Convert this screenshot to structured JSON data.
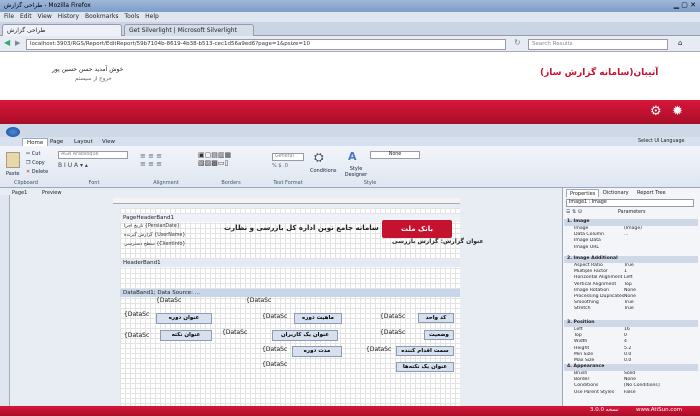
{
  "browser": {
    "title": "طراحی گزارش - Mozilla Firefox",
    "menu": [
      "File",
      "Edit",
      "View",
      "History",
      "Bookmarks",
      "Tools",
      "Help"
    ],
    "tabs": [
      "طراحی گزارش",
      "Get Silverlight | Microsoft Silverlight"
    ],
    "url": "localhost:3903/RGS/Report/EditReport/59b7104b-8619-4b38-b513-cec1d56a9ed6?page=1&psize=10",
    "search_placeholder": "Search Results"
  },
  "app": {
    "brand": "آتیبان(سامانه گزارش ساز)",
    "welcome": "خوش آمدید حسن حسین پور",
    "logout": "خروج از سیستم"
  },
  "ribbon": {
    "tabs": [
      "Home",
      "Page",
      "Layout",
      "View"
    ],
    "right_link": "Select UI Language",
    "buttons": {
      "paste": "Paste",
      "cut": "Cut",
      "copy": "Copy",
      "delete": "Delete",
      "conditions": "Conditions",
      "style_designer": "Style Designer"
    },
    "font_value": "AGA Arabesque",
    "format_value": "General",
    "style_value": "None",
    "groups": [
      "Clipboard",
      "Font",
      "Alignment",
      "Borders",
      "Text Format",
      "Style"
    ]
  },
  "doc_tabs": [
    "Page1",
    "Preview"
  ],
  "report": {
    "bands": {
      "header": "PageHeaderBand1",
      "header2": "HeaderBand1",
      "data": "DataBand1; Data Source: ..."
    },
    "header_title": "سامانه جامع نوین اداره کل بازرسی و نظارت",
    "header_subtitle": "عنوان گزارش: گزارش بازرسی",
    "logo": "بانک ملت",
    "header_fields": [
      "تاریخ اجرا {PersianDate}",
      "گزارش گیرنده {UserName}",
      "سطح دسترسی {ClientInfo}"
    ],
    "labels": [
      "کد واحد",
      "وضعیت",
      "سمت اقدام کننده",
      "عنوان یک نکته‌ها",
      "ماهیت دوره",
      "عنوان یک کاربران",
      "مدت دوره",
      "عنوان دوره",
      "عنوان نکته"
    ],
    "ds": "{DataSc"
  },
  "properties": {
    "tabs": [
      "Properties",
      "Dictionary",
      "Report Tree"
    ],
    "selected": "Image1 : Image",
    "parameters": "Parameters",
    "sections": [
      "1. Image",
      "2. Image Additional",
      "3. Position",
      "4. Appearance"
    ],
    "image_rows": [
      [
        "Image",
        "(Image)"
      ],
      [
        "Data Column",
        "..."
      ],
      [
        "Image Data",
        ""
      ],
      [
        "Image URL",
        ""
      ]
    ],
    "additional_rows": [
      [
        "Aspect Ratio",
        "True"
      ],
      [
        "Multiple Factor",
        "1"
      ],
      [
        "Horizontal Alignment",
        "Left"
      ],
      [
        "Vertical Alignment",
        "Top"
      ],
      [
        "Image Rotation",
        "None"
      ],
      [
        "Processing Duplicates",
        "None"
      ],
      [
        "Smoothing",
        "True"
      ],
      [
        "Stretch",
        "True"
      ]
    ],
    "position_rows": [
      [
        "Left",
        "16"
      ],
      [
        "Top",
        "0"
      ],
      [
        "Width",
        "4"
      ],
      [
        "Height",
        "5.2"
      ],
      [
        "Min Size",
        "0.0"
      ],
      [
        "Max Size",
        "0.0"
      ]
    ],
    "appearance_rows": [
      [
        "Brush",
        "Solid"
      ],
      [
        "Border",
        "None"
      ],
      [
        "Conditions",
        "[No Conditions]"
      ],
      [
        "Use Parent Styles",
        "False"
      ]
    ]
  },
  "status": {
    "version": "نسخه 3.0.0",
    "site": "www.AtiSun.com"
  }
}
